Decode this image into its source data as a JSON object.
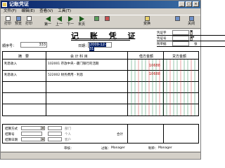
{
  "window": {
    "title": "记账凭证"
  },
  "menu": [
    "文件(F)",
    "编辑(E)",
    "查看(V)",
    "工具(T)"
  ],
  "toolbar": [
    {
      "label": "打印",
      "icon": "print-icon"
    },
    {
      "label": "预览",
      "icon": "preview-icon"
    },
    {
      "label": "打印",
      "icon": "print-icon"
    },
    {
      "label": "第一",
      "icon": "first-icon"
    },
    {
      "label": "上一",
      "icon": "prev-icon"
    },
    {
      "label": "下一",
      "icon": "next-icon"
    },
    {
      "label": "末页",
      "icon": "last-icon"
    },
    {
      "label": "",
      "icon": "add-icon"
    },
    {
      "label": "",
      "icon": "delete-icon"
    },
    {
      "label": "变换",
      "icon": "transform-icon"
    },
    {
      "label": "",
      "icon": "help-icon"
    },
    {
      "label": "关闭",
      "icon": "close-icon"
    }
  ],
  "voucher": {
    "title": "记 账 凭 证",
    "voucher_type_label": "凭证字",
    "voucher_no_label": "凭证号",
    "attachments_label": "附单据",
    "attachments_unit": "张",
    "sequence_label": "顺序号：",
    "sequence_value": "333",
    "date_label": "日期：",
    "date_value": "2009-12-31"
  },
  "table": {
    "headers": {
      "summary": "摘　要",
      "account": "会 计 科 目",
      "debit": "借方金额",
      "credit": "贷方金额"
    },
    "rows": [
      {
        "summary": "利息收入",
        "account": "102001 存放中央···厦门银行的活期",
        "amount": "10688"
      },
      {
        "summary": "利息收入",
        "account": "522002 财务费用 - 利息",
        "amount": "10688"
      },
      {
        "summary": "",
        "account": "",
        "amount": ""
      },
      {
        "summary": "",
        "account": "",
        "amount": ""
      },
      {
        "summary": "",
        "account": "",
        "amount": ""
      }
    ]
  },
  "detail": {
    "method_label": "结算方式",
    "number_label": "结算号",
    "date_label": "结算日期",
    "sub_a": "部门",
    "sub_b": "个人",
    "sub_c": "客户",
    "total_label": "合计"
  },
  "footer": {
    "approve_label": "审核：",
    "post_label": "过账：",
    "post_value": "Manager",
    "maker_label": "制单：",
    "maker_value": "Manager"
  }
}
